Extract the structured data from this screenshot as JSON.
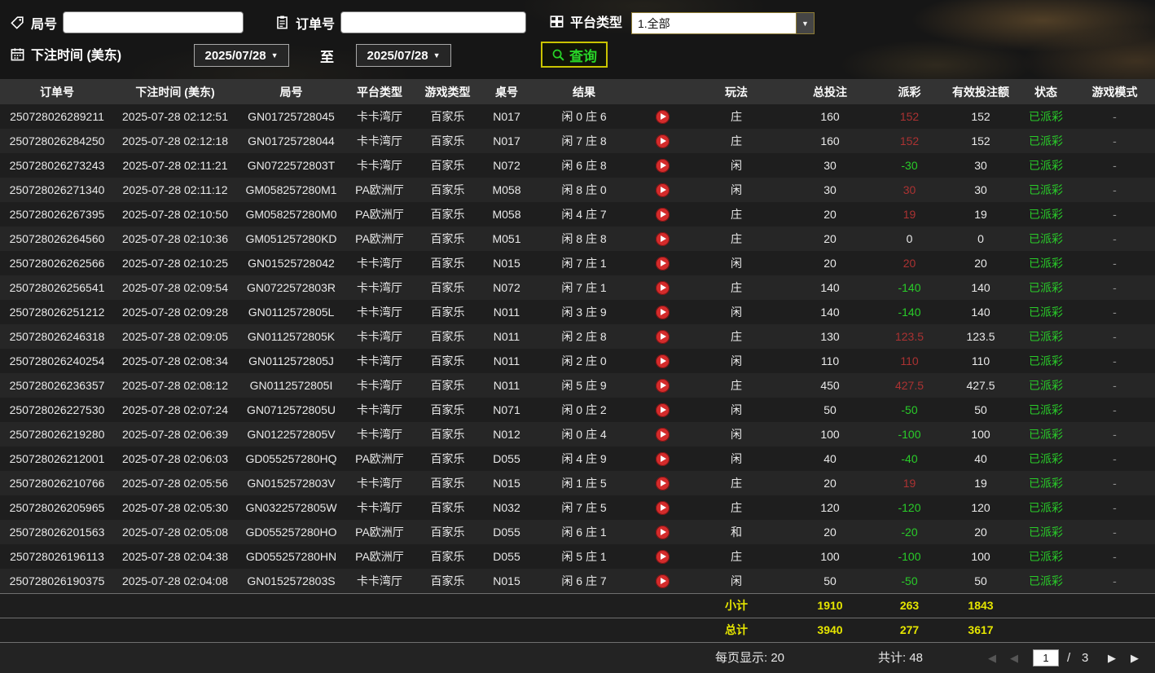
{
  "icons": {
    "round_number": "tag",
    "order_number": "clipboard",
    "platform_type": "grid",
    "bet_time": "calendar",
    "query": "magnifier",
    "play": "play-circle",
    "dropdown_arrow": "▼",
    "pager_prev": "◀",
    "pager_next": "▶"
  },
  "colors": {
    "win_red": "#ab3232",
    "loss_green": "#29cc29",
    "status_green": "#29cc29",
    "summary_yellow": "#e6e600",
    "query_green": "#28d428",
    "query_border_yellow": "#c9c400"
  },
  "filters": {
    "round_label": "局号",
    "round_value": "",
    "order_label": "订单号",
    "order_value": "",
    "platform_label": "平台类型",
    "platform_value": "1.全部",
    "bet_time_label": "下注时间 (美东)",
    "date_from": "2025/07/28",
    "to_label": "至",
    "date_to": "2025/07/28",
    "date_caret": "▼",
    "query_label": "查询"
  },
  "table": {
    "headers": [
      "订单号",
      "下注时间 (美东)",
      "局号",
      "平台类型",
      "游戏类型",
      "桌号",
      "结果",
      "玩法",
      "总投注",
      "派彩",
      "有效投注额",
      "状态",
      "游戏模式"
    ],
    "rows": [
      {
        "order_no": "250728026289211",
        "bet_time": "2025-07-28 02:12:51",
        "round_no": "GN01725728045",
        "platform": "卡卡湾厅",
        "game_type": "百家乐",
        "table_no": "N017",
        "result": "闲 0 庄 6",
        "play_type": "庄",
        "total_bet": "160",
        "payout": "152",
        "payout_color": "red",
        "valid_bet": "152",
        "status": "已派彩",
        "mode": "-"
      },
      {
        "order_no": "250728026284250",
        "bet_time": "2025-07-28 02:12:18",
        "round_no": "GN01725728044",
        "platform": "卡卡湾厅",
        "game_type": "百家乐",
        "table_no": "N017",
        "result": "闲 7 庄 8",
        "play_type": "庄",
        "total_bet": "160",
        "payout": "152",
        "payout_color": "red",
        "valid_bet": "152",
        "status": "已派彩",
        "mode": "-"
      },
      {
        "order_no": "250728026273243",
        "bet_time": "2025-07-28 02:11:21",
        "round_no": "GN0722572803T",
        "platform": "卡卡湾厅",
        "game_type": "百家乐",
        "table_no": "N072",
        "result": "闲 6 庄 8",
        "play_type": "闲",
        "total_bet": "30",
        "payout": "-30",
        "payout_color": "green",
        "valid_bet": "30",
        "status": "已派彩",
        "mode": "-"
      },
      {
        "order_no": "250728026271340",
        "bet_time": "2025-07-28 02:11:12",
        "round_no": "GM058257280M1",
        "platform": "PA欧洲厅",
        "game_type": "百家乐",
        "table_no": "M058",
        "result": "闲 8 庄 0",
        "play_type": "闲",
        "total_bet": "30",
        "payout": "30",
        "payout_color": "red",
        "valid_bet": "30",
        "status": "已派彩",
        "mode": "-"
      },
      {
        "order_no": "250728026267395",
        "bet_time": "2025-07-28 02:10:50",
        "round_no": "GM058257280M0",
        "platform": "PA欧洲厅",
        "game_type": "百家乐",
        "table_no": "M058",
        "result": "闲 4 庄 7",
        "play_type": "庄",
        "total_bet": "20",
        "payout": "19",
        "payout_color": "red",
        "valid_bet": "19",
        "status": "已派彩",
        "mode": "-"
      },
      {
        "order_no": "250728026264560",
        "bet_time": "2025-07-28 02:10:36",
        "round_no": "GM051257280KD",
        "platform": "PA欧洲厅",
        "game_type": "百家乐",
        "table_no": "M051",
        "result": "闲 8 庄 8",
        "play_type": "庄",
        "total_bet": "20",
        "payout": "0",
        "payout_color": "neutral",
        "valid_bet": "0",
        "status": "已派彩",
        "mode": "-"
      },
      {
        "order_no": "250728026262566",
        "bet_time": "2025-07-28 02:10:25",
        "round_no": "GN01525728042",
        "platform": "卡卡湾厅",
        "game_type": "百家乐",
        "table_no": "N015",
        "result": "闲 7 庄 1",
        "play_type": "闲",
        "total_bet": "20",
        "payout": "20",
        "payout_color": "red",
        "valid_bet": "20",
        "status": "已派彩",
        "mode": "-"
      },
      {
        "order_no": "250728026256541",
        "bet_time": "2025-07-28 02:09:54",
        "round_no": "GN0722572803R",
        "platform": "卡卡湾厅",
        "game_type": "百家乐",
        "table_no": "N072",
        "result": "闲 7 庄 1",
        "play_type": "庄",
        "total_bet": "140",
        "payout": "-140",
        "payout_color": "green",
        "valid_bet": "140",
        "status": "已派彩",
        "mode": "-"
      },
      {
        "order_no": "250728026251212",
        "bet_time": "2025-07-28 02:09:28",
        "round_no": "GN0112572805L",
        "platform": "卡卡湾厅",
        "game_type": "百家乐",
        "table_no": "N011",
        "result": "闲 3 庄 9",
        "play_type": "闲",
        "total_bet": "140",
        "payout": "-140",
        "payout_color": "green",
        "valid_bet": "140",
        "status": "已派彩",
        "mode": "-"
      },
      {
        "order_no": "250728026246318",
        "bet_time": "2025-07-28 02:09:05",
        "round_no": "GN0112572805K",
        "platform": "卡卡湾厅",
        "game_type": "百家乐",
        "table_no": "N011",
        "result": "闲 2 庄 8",
        "play_type": "庄",
        "total_bet": "130",
        "payout": "123.5",
        "payout_color": "red",
        "valid_bet": "123.5",
        "status": "已派彩",
        "mode": "-"
      },
      {
        "order_no": "250728026240254",
        "bet_time": "2025-07-28 02:08:34",
        "round_no": "GN0112572805J",
        "platform": "卡卡湾厅",
        "game_type": "百家乐",
        "table_no": "N011",
        "result": "闲 2 庄 0",
        "play_type": "闲",
        "total_bet": "110",
        "payout": "110",
        "payout_color": "red",
        "valid_bet": "110",
        "status": "已派彩",
        "mode": "-"
      },
      {
        "order_no": "250728026236357",
        "bet_time": "2025-07-28 02:08:12",
        "round_no": "GN0112572805I",
        "platform": "卡卡湾厅",
        "game_type": "百家乐",
        "table_no": "N011",
        "result": "闲 5 庄 9",
        "play_type": "庄",
        "total_bet": "450",
        "payout": "427.5",
        "payout_color": "red",
        "valid_bet": "427.5",
        "status": "已派彩",
        "mode": "-"
      },
      {
        "order_no": "250728026227530",
        "bet_time": "2025-07-28 02:07:24",
        "round_no": "GN0712572805U",
        "platform": "卡卡湾厅",
        "game_type": "百家乐",
        "table_no": "N071",
        "result": "闲 0 庄 2",
        "play_type": "闲",
        "total_bet": "50",
        "payout": "-50",
        "payout_color": "green",
        "valid_bet": "50",
        "status": "已派彩",
        "mode": "-"
      },
      {
        "order_no": "250728026219280",
        "bet_time": "2025-07-28 02:06:39",
        "round_no": "GN0122572805V",
        "platform": "卡卡湾厅",
        "game_type": "百家乐",
        "table_no": "N012",
        "result": "闲 0 庄 4",
        "play_type": "闲",
        "total_bet": "100",
        "payout": "-100",
        "payout_color": "green",
        "valid_bet": "100",
        "status": "已派彩",
        "mode": "-"
      },
      {
        "order_no": "250728026212001",
        "bet_time": "2025-07-28 02:06:03",
        "round_no": "GD055257280HQ",
        "platform": "PA欧洲厅",
        "game_type": "百家乐",
        "table_no": "D055",
        "result": "闲 4 庄 9",
        "play_type": "闲",
        "total_bet": "40",
        "payout": "-40",
        "payout_color": "green",
        "valid_bet": "40",
        "status": "已派彩",
        "mode": "-"
      },
      {
        "order_no": "250728026210766",
        "bet_time": "2025-07-28 02:05:56",
        "round_no": "GN0152572803V",
        "platform": "卡卡湾厅",
        "game_type": "百家乐",
        "table_no": "N015",
        "result": "闲 1 庄 5",
        "play_type": "庄",
        "total_bet": "20",
        "payout": "19",
        "payout_color": "red",
        "valid_bet": "19",
        "status": "已派彩",
        "mode": "-"
      },
      {
        "order_no": "250728026205965",
        "bet_time": "2025-07-28 02:05:30",
        "round_no": "GN0322572805W",
        "platform": "卡卡湾厅",
        "game_type": "百家乐",
        "table_no": "N032",
        "result": "闲 7 庄 5",
        "play_type": "庄",
        "total_bet": "120",
        "payout": "-120",
        "payout_color": "green",
        "valid_bet": "120",
        "status": "已派彩",
        "mode": "-"
      },
      {
        "order_no": "250728026201563",
        "bet_time": "2025-07-28 02:05:08",
        "round_no": "GD055257280HO",
        "platform": "PA欧洲厅",
        "game_type": "百家乐",
        "table_no": "D055",
        "result": "闲 6 庄 1",
        "play_type": "和",
        "total_bet": "20",
        "payout": "-20",
        "payout_color": "green",
        "valid_bet": "20",
        "status": "已派彩",
        "mode": "-"
      },
      {
        "order_no": "250728026196113",
        "bet_time": "2025-07-28 02:04:38",
        "round_no": "GD055257280HN",
        "platform": "PA欧洲厅",
        "game_type": "百家乐",
        "table_no": "D055",
        "result": "闲 5 庄 1",
        "play_type": "庄",
        "total_bet": "100",
        "payout": "-100",
        "payout_color": "green",
        "valid_bet": "100",
        "status": "已派彩",
        "mode": "-"
      },
      {
        "order_no": "250728026190375",
        "bet_time": "2025-07-28 02:04:08",
        "round_no": "GN0152572803S",
        "platform": "卡卡湾厅",
        "game_type": "百家乐",
        "table_no": "N015",
        "result": "闲 6 庄 7",
        "play_type": "闲",
        "total_bet": "50",
        "payout": "-50",
        "payout_color": "green",
        "valid_bet": "50",
        "status": "已派彩",
        "mode": "-"
      }
    ]
  },
  "summary": {
    "subtotal_label": "小计",
    "subtotal_total_bet": "1910",
    "subtotal_payout": "263",
    "subtotal_valid_bet": "1843",
    "total_label": "总计",
    "total_total_bet": "3940",
    "total_payout": "277",
    "total_valid_bet": "3617"
  },
  "pagination": {
    "per_page_label": "每页显示:",
    "per_page_value": "20",
    "total_label": "共计:",
    "total_value": "48",
    "current_page": "1",
    "separator": "/",
    "total_pages": "3"
  }
}
